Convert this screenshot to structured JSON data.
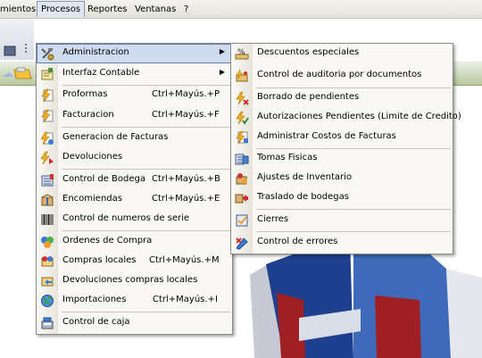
{
  "menubar": {
    "items": [
      "mientos",
      "Procesos",
      "Reportes",
      "Ventanas",
      "?"
    ]
  },
  "procesos_menu": {
    "items": [
      {
        "label": "Administracion",
        "shortcut": "",
        "icon": "tools-icon",
        "submenu": true,
        "highlighted": true
      },
      {
        "label": "Interfaz Contable",
        "shortcut": "",
        "icon": "accounting-icon",
        "submenu": true
      },
      {
        "label": "Proformas",
        "shortcut": "Ctrl+Mayús.+P",
        "icon": "lightning-doc-icon"
      },
      {
        "label": "Facturacion",
        "shortcut": "Ctrl+Mayús.+F",
        "icon": "lightning-doc-icon"
      },
      {
        "label": "Generacion de Facturas",
        "shortcut": "",
        "icon": "invoice-gen-icon"
      },
      {
        "label": "Devoluciones",
        "shortcut": "",
        "icon": "returns-icon"
      },
      {
        "label": "Control de Bodega",
        "shortcut": "Ctrl+Mayús.+B",
        "icon": "warehouse-icon"
      },
      {
        "label": "Encomiendas",
        "shortcut": "Ctrl+Mayús.+E",
        "icon": "package-icon"
      },
      {
        "label": "Control de numeros de serie",
        "shortcut": "",
        "icon": "barcode-icon"
      },
      {
        "label": "Ordenes de Compra",
        "shortcut": "",
        "icon": "purchase-order-icon"
      },
      {
        "label": "Compras locales",
        "shortcut": "Ctrl+Mayús.+M",
        "icon": "local-purchase-icon"
      },
      {
        "label": "Devoluciones compras locales",
        "shortcut": "",
        "icon": "purchase-return-icon"
      },
      {
        "label": "Importaciones",
        "shortcut": "Ctrl+Mayús.+I",
        "icon": "globe-icon"
      },
      {
        "label": "Control de caja",
        "shortcut": "",
        "icon": "cash-register-icon"
      }
    ]
  },
  "admin_submenu": {
    "items": [
      {
        "label": "Descuentos especiales",
        "icon": "percent-icon"
      },
      {
        "label": "Control de auditoria por documentos",
        "icon": "audit-icon"
      },
      {
        "label": "Borrado de pendientes",
        "icon": "erase-icon"
      },
      {
        "label": "Autorizaciones Pendientes (Limite de Credito)",
        "icon": "authorization-icon"
      },
      {
        "label": "Administrar Costos de Facturas",
        "icon": "costs-icon"
      },
      {
        "label": "Tomas Fisicas",
        "icon": "inventory-count-icon"
      },
      {
        "label": "Ajustes de Inventario",
        "icon": "inventory-adjust-icon"
      },
      {
        "label": "Traslado de bodegas",
        "icon": "transfer-icon"
      },
      {
        "label": "Cierres",
        "icon": "close-period-icon"
      },
      {
        "label": "Control de errores",
        "icon": "error-control-icon"
      }
    ]
  },
  "colors": {
    "menu_bg": "#f9f8f4",
    "highlight": "#cfdcef",
    "highlight_border": "#5c7fb7",
    "toolbar_green": "#b8c99f",
    "logo_blue": "#1f3f8f",
    "logo_red": "#a01f22"
  }
}
